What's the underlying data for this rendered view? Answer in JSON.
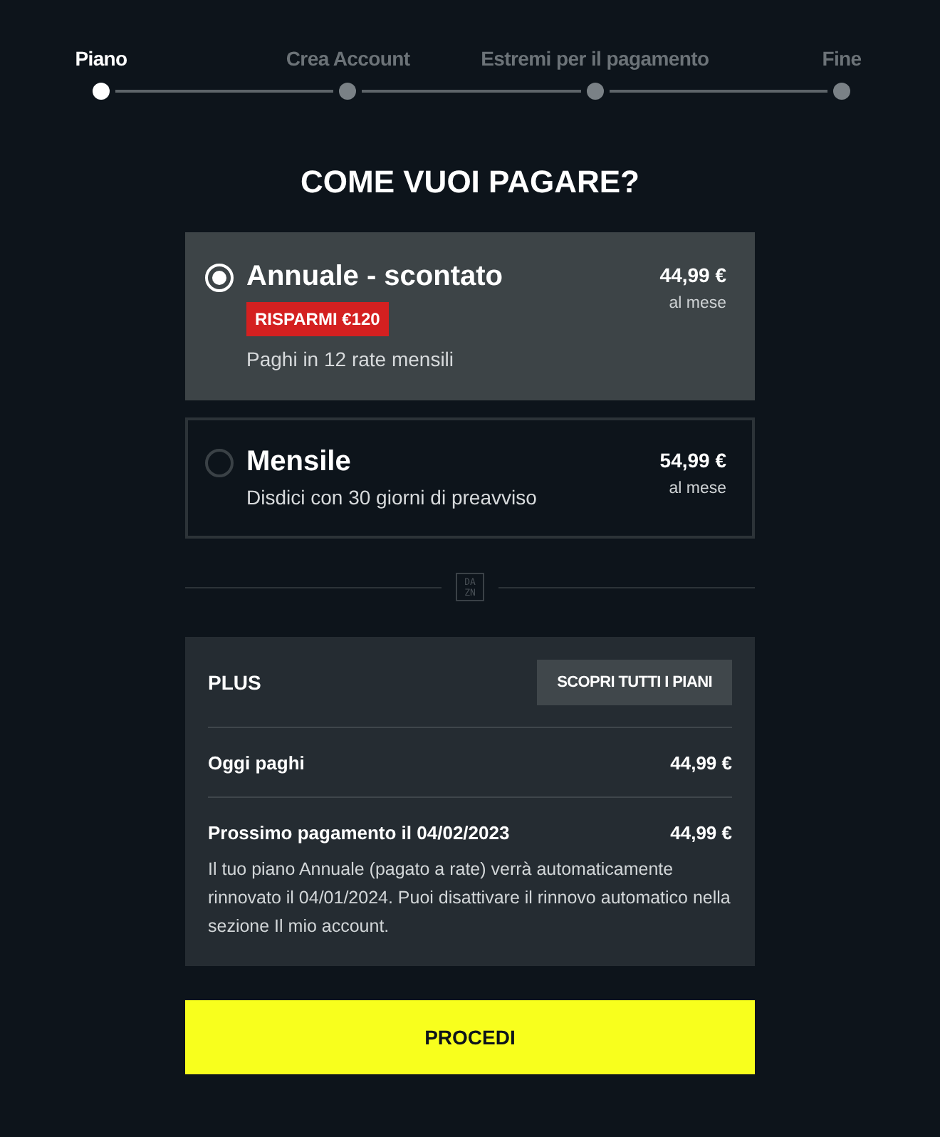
{
  "steps": [
    {
      "label": "Piano",
      "selected": true
    },
    {
      "label": "Crea Account",
      "selected": false
    },
    {
      "label": "Estremi per il pagamento",
      "selected": false
    },
    {
      "label": "Fine",
      "selected": false
    }
  ],
  "title": "COME VUOI PAGARE?",
  "plans": [
    {
      "name": "Annuale - scontato",
      "selected": true,
      "badge": "RISPARMI €120",
      "description": "Paghi in 12 rate mensili",
      "price": "44,99 €",
      "period": "al mese"
    },
    {
      "name": "Mensile",
      "selected": false,
      "description": "Disdici con 30 giorni di preavviso",
      "price": "54,99 €",
      "period": "al mese"
    }
  ],
  "logo": {
    "top": "DA",
    "bottom": "ZN"
  },
  "summary": {
    "plan": "PLUS",
    "button": "SCOPRI TUTTI I PIANI",
    "rows": [
      {
        "label": "Oggi paghi",
        "amount": "44,99 €"
      },
      {
        "label": "Prossimo pagamento il 04/02/2023",
        "amount": "44,99 €",
        "note": "Il tuo piano Annuale (pagato a rate) verrà automaticamente rinnovato il 04/01/2024. Puoi disattivare il rinnovo automatico nella sezione Il mio account."
      }
    ]
  },
  "proceed": "PROCEDI"
}
